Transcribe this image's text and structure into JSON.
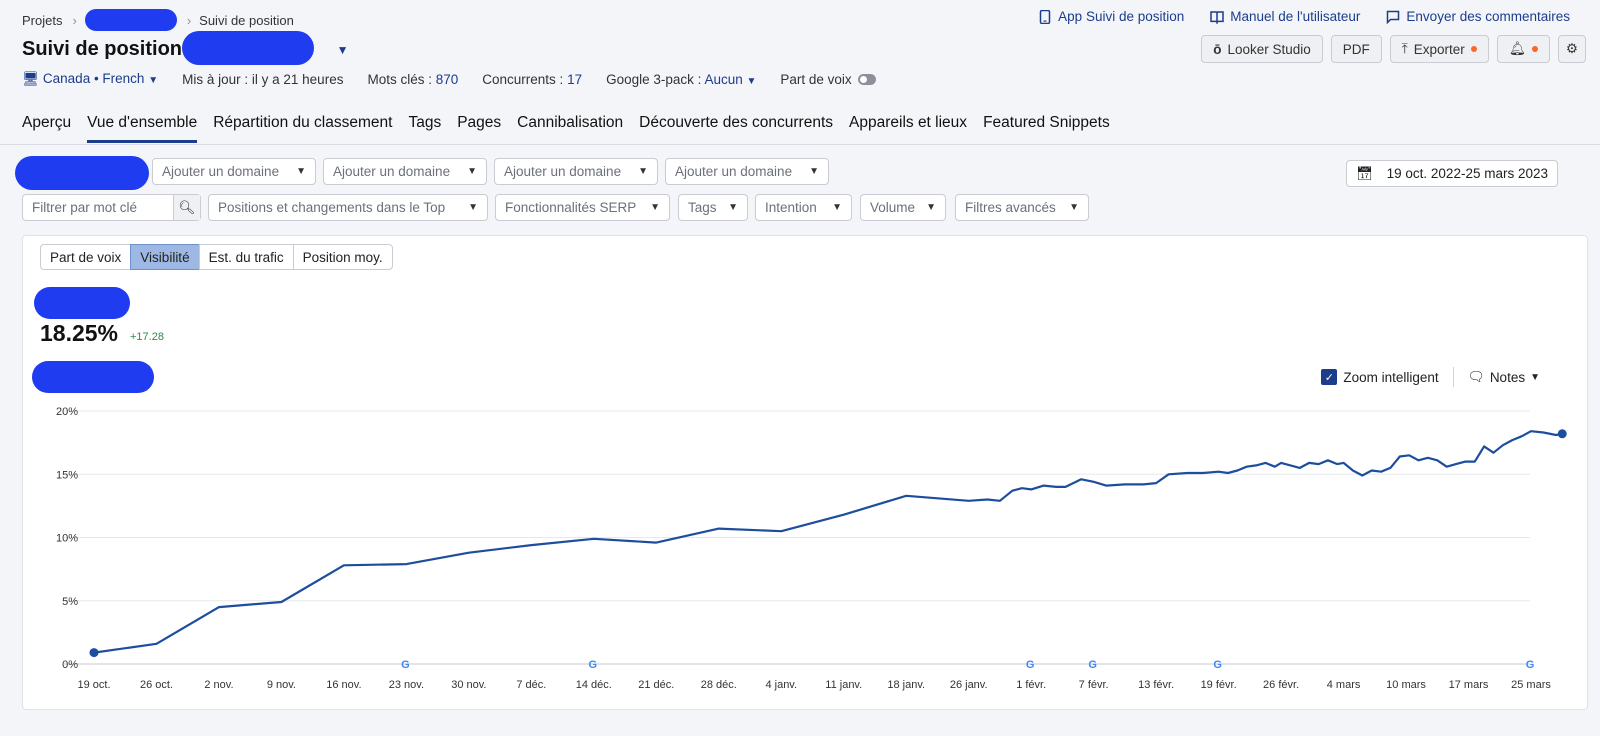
{
  "breadcrumb": {
    "root": "Projets",
    "current": "Suivi de position"
  },
  "top_links": [
    "App Suivi de position",
    "Manuel de l'utilisateur",
    "Envoyer des commentaires"
  ],
  "title": "Suivi de position:",
  "actions": {
    "looker": "Looker Studio",
    "pdf": "PDF",
    "export": "Exporter"
  },
  "meta": {
    "location": "Canada • French",
    "updated": "Mis à jour : il y a 21 heures",
    "keywords_label": "Mots clés :",
    "keywords_value": "870",
    "competitors_label": "Concurrents :",
    "competitors_value": "17",
    "pack_label": "Google 3-pack :",
    "pack_value": "Aucun",
    "sov_label": "Part de voix"
  },
  "tabs": [
    "Aperçu",
    "Vue d'ensemble",
    "Répartition du classement",
    "Tags",
    "Pages",
    "Cannibalisation",
    "Découverte des concurrents",
    "Appareils et lieux",
    "Featured Snippets"
  ],
  "domain_placeholder": "Ajouter un domaine",
  "date_range": "19 oct. 2022-25 mars 2023",
  "filters": {
    "keyword_placeholder": "Filtrer par mot clé",
    "positions": "Positions et changements dans le Top",
    "serp": "Fonctionnalités SERP",
    "tags": "Tags",
    "intent": "Intention",
    "volume": "Volume",
    "advanced": "Filtres avancés"
  },
  "metric_tabs": [
    "Part de voix",
    "Visibilité",
    "Est. du trafic",
    "Position moy."
  ],
  "summary": {
    "value": "18.25%",
    "delta": "+17.28"
  },
  "controls": {
    "smart_zoom": "Zoom intelligent",
    "notes": "Notes"
  },
  "colors": {
    "accent": "#1b3d8c",
    "line": "#1d4e9e",
    "redaction": "#1f3cf0"
  },
  "chart_data": {
    "type": "line",
    "ylim": [
      0,
      20
    ],
    "yticks": [
      "0%",
      "5%",
      "10%",
      "15%",
      "20%"
    ],
    "xlabels": [
      "19 oct.",
      "26 oct.",
      "2 nov.",
      "9 nov.",
      "16 nov.",
      "23 nov.",
      "30 nov.",
      "7 déc.",
      "14 déc.",
      "21 déc.",
      "28 déc.",
      "4 janv.",
      "11 janv.",
      "18 janv.",
      "26 janv.",
      "1 févr.",
      "7 févr.",
      "13 févr.",
      "19 févr.",
      "26 févr.",
      "4 mars",
      "10 mars",
      "17 mars",
      "25 mars"
    ],
    "google_update_markers": [
      "23 nov.",
      "14 déc.",
      "1 févr.",
      "7 févr.",
      "19 févr.",
      "25 mars"
    ],
    "grid": true,
    "series": [
      {
        "points": [
          [
            0,
            0.9
          ],
          [
            1,
            1.6
          ],
          [
            2,
            4.5
          ],
          [
            3,
            4.9
          ],
          [
            4,
            7.8
          ],
          [
            5,
            7.9
          ],
          [
            6,
            8.8
          ],
          [
            7,
            9.4
          ],
          [
            8,
            9.9
          ],
          [
            9,
            9.6
          ],
          [
            10,
            10.7
          ],
          [
            11,
            10.5
          ],
          [
            12,
            11.8
          ],
          [
            13,
            13.3
          ],
          [
            14,
            12.9
          ],
          [
            14.3,
            13.0
          ],
          [
            14.5,
            12.9
          ],
          [
            14.7,
            13.7
          ],
          [
            14.85,
            13.9
          ],
          [
            15,
            13.8
          ],
          [
            15.2,
            14.1
          ],
          [
            15.4,
            14.0
          ],
          [
            15.55,
            14.0
          ],
          [
            15.8,
            14.6
          ],
          [
            16,
            14.4
          ],
          [
            16.2,
            14.1
          ],
          [
            16.5,
            14.2
          ],
          [
            16.8,
            14.2
          ],
          [
            17,
            14.3
          ],
          [
            17.2,
            15.0
          ],
          [
            17.5,
            15.1
          ],
          [
            17.75,
            15.1
          ],
          [
            18,
            15.2
          ],
          [
            18.15,
            15.1
          ],
          [
            18.3,
            15.3
          ],
          [
            18.45,
            15.6
          ],
          [
            18.6,
            15.7
          ],
          [
            18.75,
            15.9
          ],
          [
            18.9,
            15.6
          ],
          [
            19,
            15.9
          ],
          [
            19.15,
            15.7
          ],
          [
            19.3,
            15.5
          ],
          [
            19.45,
            15.9
          ],
          [
            19.6,
            15.8
          ],
          [
            19.75,
            16.1
          ],
          [
            19.9,
            15.8
          ],
          [
            20,
            15.9
          ],
          [
            20.15,
            15.3
          ],
          [
            20.3,
            14.9
          ],
          [
            20.45,
            15.3
          ],
          [
            20.6,
            15.2
          ],
          [
            20.75,
            15.5
          ],
          [
            20.9,
            16.4
          ],
          [
            21.05,
            16.5
          ],
          [
            21.2,
            16.1
          ],
          [
            21.35,
            16.3
          ],
          [
            21.5,
            16.1
          ],
          [
            21.65,
            15.6
          ],
          [
            21.8,
            15.8
          ],
          [
            21.95,
            16.0
          ],
          [
            22.1,
            16.0
          ],
          [
            22.25,
            17.2
          ],
          [
            22.4,
            16.7
          ],
          [
            22.55,
            17.3
          ],
          [
            22.7,
            17.7
          ],
          [
            22.85,
            18.0
          ],
          [
            23,
            18.4
          ],
          [
            23.2,
            18.3
          ],
          [
            23.4,
            18.1
          ],
          [
            23.5,
            18.2
          ]
        ]
      }
    ]
  }
}
